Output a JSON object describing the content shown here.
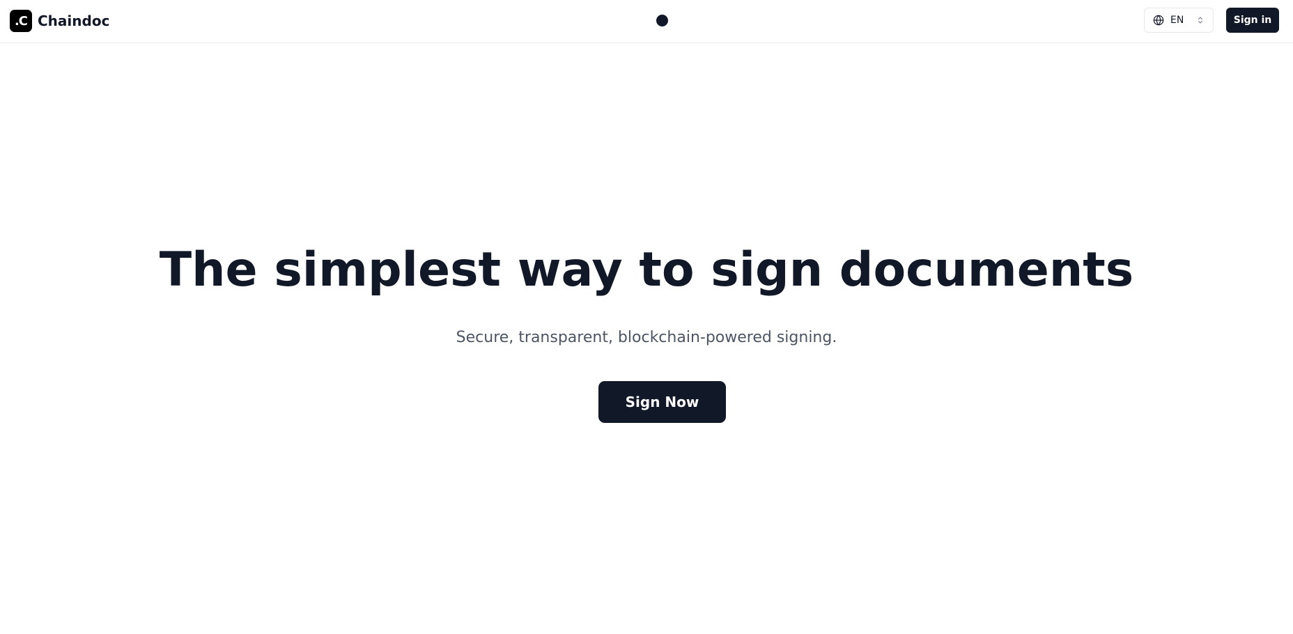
{
  "header": {
    "brand_logo_text": ".C",
    "brand_name": "Chaindoc",
    "language": {
      "icon": "globe-icon",
      "selected": "EN",
      "chevron_icon": "chevron-up-down-icon"
    },
    "signin_label": "Sign in"
  },
  "hero": {
    "title": "The simplest way to sign documents",
    "subtitle": "Secure, transparent, blockchain-powered signing.",
    "cta_label": "Sign Now"
  },
  "colors": {
    "primary": "#111827",
    "subtitle": "#4b5563",
    "border": "#e5e7eb",
    "background": "#ffffff"
  }
}
